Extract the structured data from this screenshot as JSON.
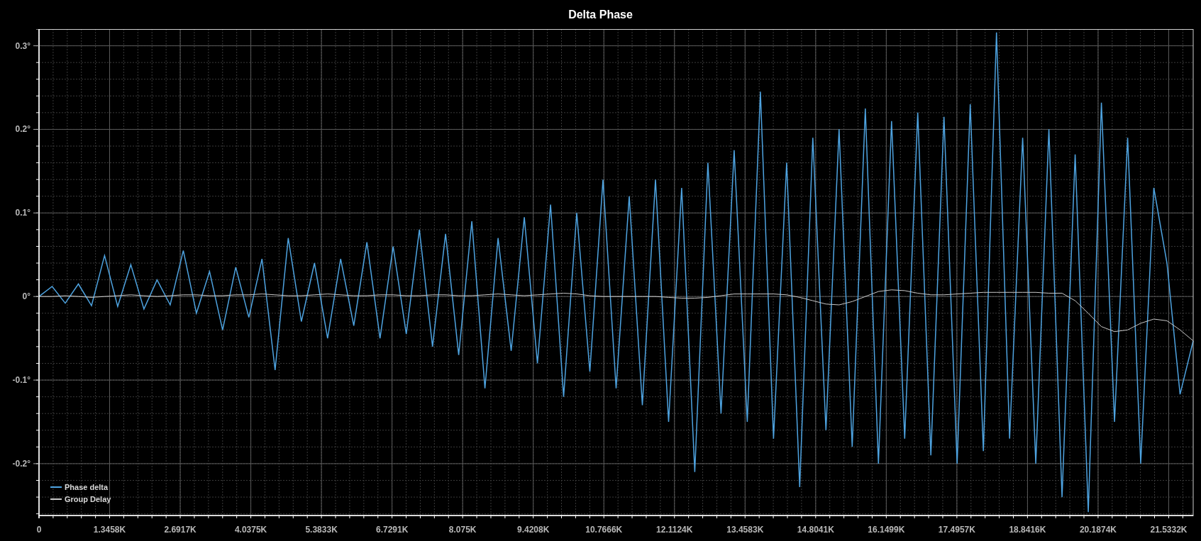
{
  "chart": {
    "chart_data": {
      "type": "line",
      "title": "Delta Phase",
      "x": [
        0,
        0.25,
        0.5,
        0.75,
        1,
        1.25,
        1.5,
        1.75,
        2,
        2.25,
        2.5,
        2.75,
        3,
        3.25,
        3.5,
        3.75,
        4,
        4.25,
        4.5,
        4.75,
        5,
        5.25,
        5.5,
        5.75,
        6,
        6.25,
        6.5,
        6.75,
        7,
        7.25,
        7.5,
        7.75,
        8,
        8.25,
        8.5,
        8.75,
        9,
        9.25,
        9.5,
        9.75,
        10,
        10.25,
        10.5,
        10.75,
        11,
        11.25,
        11.5,
        11.75,
        12,
        12.25,
        12.5,
        12.75,
        13,
        13.25,
        13.5,
        13.75,
        14,
        14.25,
        14.5,
        14.75,
        15,
        15.25,
        15.5,
        15.75,
        16,
        16.25,
        16.5,
        16.75,
        17,
        17.25,
        17.5,
        17.75,
        18,
        18.25,
        18.5,
        18.75,
        19,
        19.25,
        19.5,
        19.75,
        20,
        20.25,
        20.5,
        20.75,
        21,
        21.25,
        21.5,
        21.75,
        22
      ],
      "series": [
        {
          "name": "Phase delta",
          "color": "#4ea3e0",
          "values": [
            0,
            0.012,
            -0.008,
            0.015,
            -0.011,
            0.049,
            -0.012,
            0.038,
            -0.015,
            0.02,
            -0.01,
            0.055,
            -0.02,
            0.03,
            -0.04,
            0.035,
            -0.025,
            0.045,
            -0.088,
            0.07,
            -0.03,
            0.04,
            -0.05,
            0.045,
            -0.035,
            0.065,
            -0.05,
            0.06,
            -0.045,
            0.08,
            -0.06,
            0.075,
            -0.07,
            0.09,
            -0.11,
            0.07,
            -0.065,
            0.095,
            -0.08,
            0.11,
            -0.12,
            0.1,
            -0.09,
            0.14,
            -0.11,
            0.12,
            -0.13,
            0.14,
            -0.15,
            0.13,
            -0.21,
            0.16,
            -0.14,
            0.175,
            -0.15,
            0.245,
            -0.17,
            0.16,
            -0.228,
            0.19,
            -0.16,
            0.2,
            -0.18,
            0.225,
            -0.2,
            0.21,
            -0.17,
            0.22,
            -0.19,
            0.215,
            -0.2,
            0.23,
            -0.185,
            0.316,
            -0.17,
            0.19,
            -0.2,
            0.2,
            -0.24,
            0.17,
            -0.258,
            0.232,
            -0.15,
            0.19,
            -0.2,
            0.13,
            0.04,
            -0.117,
            -0.053
          ]
        },
        {
          "name": "Group Delay",
          "color": "#c8c8c8",
          "values": [
            0,
            0,
            0.001,
            0,
            -0.001,
            0,
            0.001,
            0.002,
            0.001,
            0,
            0.001,
            0.002,
            0.002,
            0.001,
            0.001,
            0.002,
            0.002,
            0.003,
            0.002,
            0.001,
            0.001,
            0.002,
            0.003,
            0.002,
            0.001,
            0.001,
            0.002,
            0.002,
            0.001,
            0.001,
            0.002,
            0.002,
            0.001,
            0.001,
            0.002,
            0.003,
            0.002,
            0.001,
            0.002,
            0.003,
            0.004,
            0.003,
            0.001,
            0,
            0,
            0,
            0,
            0,
            -0.001,
            -0.002,
            -0.002,
            -0.001,
            0.001,
            0.003,
            0.003,
            0.003,
            0.003,
            0.002,
            -0.001,
            -0.005,
            -0.009,
            -0.01,
            -0.006,
            0,
            0.006,
            0.008,
            0.007,
            0.004,
            0.002,
            0.002,
            0.003,
            0.004,
            0.005,
            0.005,
            0.005,
            0.005,
            0.005,
            0.004,
            0.004,
            -0.005,
            -0.02,
            -0.036,
            -0.042,
            -0.04,
            -0.032,
            -0.027,
            -0.029,
            -0.04,
            -0.053
          ]
        }
      ],
      "grid": true,
      "legend": "lower left",
      "xlim": [
        0,
        22
      ],
      "ylim": [
        -0.262,
        0.32
      ],
      "xticks": [
        {
          "value": 0,
          "label": "0"
        },
        {
          "value": 1.3458,
          "label": "1.3458K"
        },
        {
          "value": 2.6917,
          "label": "2.6917K"
        },
        {
          "value": 4.0375,
          "label": "4.0375K"
        },
        {
          "value": 5.3833,
          "label": "5.3833K"
        },
        {
          "value": 6.7291,
          "label": "6.7291K"
        },
        {
          "value": 8.075,
          "label": "8.075K"
        },
        {
          "value": 9.4208,
          "label": "9.4208K"
        },
        {
          "value": 10.7666,
          "label": "10.7666K"
        },
        {
          "value": 12.1124,
          "label": "12.1124K"
        },
        {
          "value": 13.4583,
          "label": "13.4583K"
        },
        {
          "value": 14.8041,
          "label": "14.8041K"
        },
        {
          "value": 16.1499,
          "label": "16.1499K"
        },
        {
          "value": 17.4957,
          "label": "17.4957K"
        },
        {
          "value": 18.8416,
          "label": "18.8416K"
        },
        {
          "value": 20.1874,
          "label": "20.1874K"
        },
        {
          "value": 21.5332,
          "label": "21.5332K"
        }
      ],
      "yticks": [
        {
          "value": 0.3,
          "label": "0.3°"
        },
        {
          "value": 0.2,
          "label": "0.2°"
        },
        {
          "value": 0.1,
          "label": "0.1°"
        },
        {
          "value": 0,
          "label": "0°"
        },
        {
          "value": -0.1,
          "label": "-0.1°"
        },
        {
          "value": -0.2,
          "label": "-0.2°"
        }
      ]
    }
  }
}
